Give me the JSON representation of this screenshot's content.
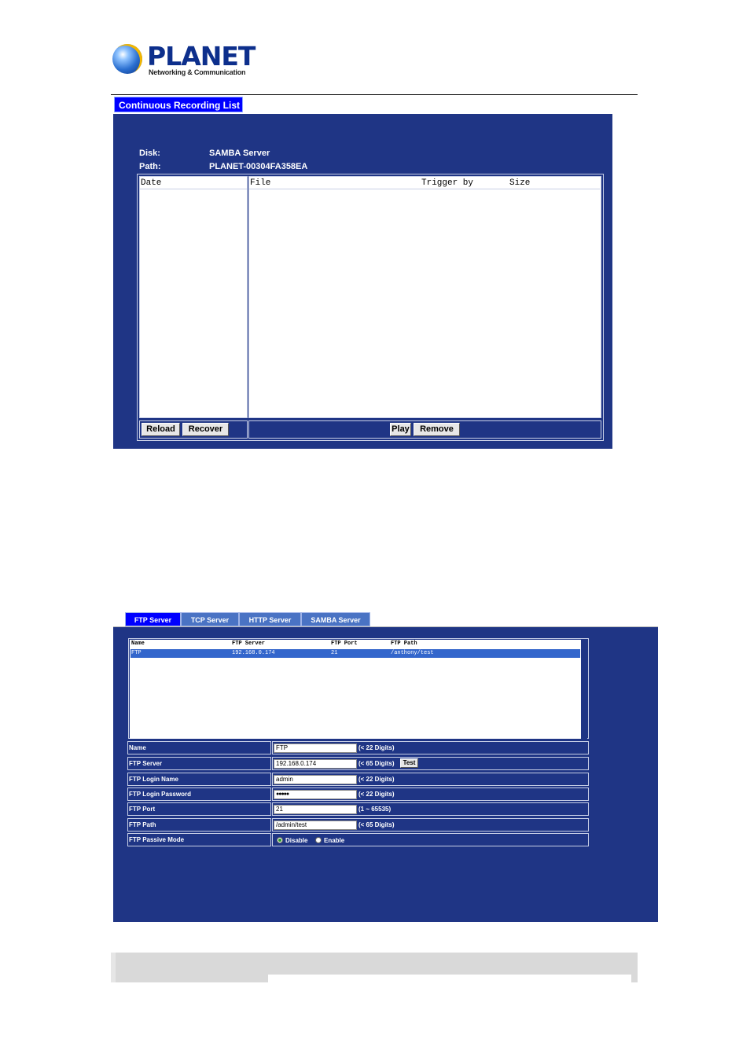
{
  "brand": {
    "name": "PLANET",
    "tagline": "Networking & Communication"
  },
  "recording": {
    "tab_title": "Continuous Recording List",
    "disk_label": "Disk:",
    "disk_value": "SAMBA Server",
    "path_label": "Path:",
    "path_value": "PLANET-00304FA358EA",
    "date_header": "Date",
    "file_header": "File",
    "trigger_header": "Trigger by",
    "size_header": "Size",
    "reload_label": "Reload",
    "recover_label": "Recover",
    "play_label": "Play",
    "remove_label": "Remove"
  },
  "server_tabs": [
    "FTP Server",
    "TCP Server",
    "HTTP Server",
    "SAMBA Server"
  ],
  "ftp_list": {
    "headers": [
      "Name",
      "FTP Server",
      "FTP Port",
      "FTP Path"
    ],
    "rows": [
      [
        "FTP",
        "192.168.0.174",
        "21",
        "/anthony/test"
      ]
    ]
  },
  "ftp_form": {
    "name_label": "Name",
    "name_value": "FTP",
    "name_hint": "(< 22 Digits)",
    "server_label": "FTP Server",
    "server_value": "192.168.0.174",
    "server_hint": "(< 65 Digits)",
    "test_label": "Test",
    "login_label": "FTP Login Name",
    "login_value": "admin",
    "login_hint": "(< 22 Digits)",
    "password_label": "FTP Login Password",
    "password_value": "●●●●●",
    "password_hint": "(< 22 Digits)",
    "port_label": "FTP Port",
    "port_value": "21",
    "port_hint": "(1 ~ 65535)",
    "path_label": "FTP Path",
    "path_value": "/admin/test",
    "path_hint": "(< 65 Digits)",
    "passive_label": "FTP Passive Mode",
    "passive_disable": "Disable",
    "passive_enable": "Enable",
    "passive_selected": "Disable"
  }
}
